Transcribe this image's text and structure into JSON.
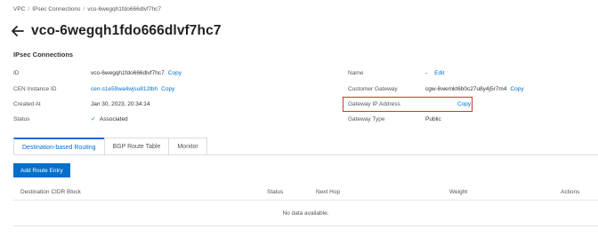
{
  "breadcrumb": {
    "items": [
      "VPC",
      "IPsec Connections",
      "vco-6wegqh1fdo666dlvf7hc7"
    ],
    "separator": "/"
  },
  "header": {
    "title": "vco-6wegqh1fdo666dlvf7hc7"
  },
  "section": {
    "title": "IPsec Connections"
  },
  "details": {
    "id": {
      "label": "ID",
      "value": "vco-6wegqh1fdo666dlvf7hc7",
      "action": "Copy"
    },
    "cen": {
      "label": "CEN Instance ID",
      "value": "cen-s1e59wa4wjsu812tbh",
      "action": "Copy"
    },
    "created": {
      "label": "Created At",
      "value": "Jan 30, 2023, 20:34:14"
    },
    "status": {
      "label": "Status",
      "value": "Associated",
      "icon": "check-icon"
    },
    "name": {
      "label": "Name",
      "value": "-",
      "action": "Edit"
    },
    "customer_gateway": {
      "label": "Customer Gateway",
      "value": "cgw-6wemkt6b0c27u8y4j5r7m4",
      "action": "Copy"
    },
    "gateway_ip": {
      "label": "Gateway IP Address",
      "value": "",
      "action": "Copy"
    },
    "gateway_type": {
      "label": "Gateway Type",
      "value": "Public"
    }
  },
  "tabs": [
    "Destination-based Routing",
    "BGP Route Table",
    "Monitor"
  ],
  "active_tab": "Destination-based Routing",
  "toolbar": {
    "add_label": "Add Route Entry"
  },
  "table": {
    "columns": [
      "Destination CIDR Block",
      "Status",
      "Next Hop",
      "Weight",
      "Actions"
    ],
    "empty_text": "No data available."
  },
  "colors": {
    "accent": "#0070cc",
    "highlight": "#d9312a",
    "success": "#2ca02c"
  }
}
